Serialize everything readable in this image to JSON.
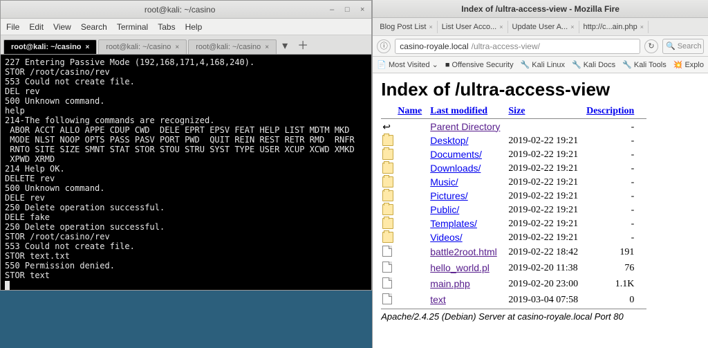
{
  "terminal": {
    "title": "root@kali: ~/casino",
    "menu": [
      "File",
      "Edit",
      "View",
      "Search",
      "Terminal",
      "Tabs",
      "Help"
    ],
    "tabs": [
      {
        "label": "root@kali: ~/casino",
        "active": true
      },
      {
        "label": "root@kali: ~/casino",
        "active": false
      },
      {
        "label": "root@kali: ~/casino",
        "active": false
      }
    ],
    "lines": [
      "227 Entering Passive Mode (192,168,171,4,168,240).",
      "STOR /root/casino/rev",
      "553 Could not create file.",
      "DEL rev",
      "500 Unknown command.",
      "help",
      "214-The following commands are recognized.",
      " ABOR ACCT ALLO APPE CDUP CWD  DELE EPRT EPSV FEAT HELP LIST MDTM MKD",
      " MODE NLST NOOP OPTS PASS PASV PORT PWD  QUIT REIN REST RETR RMD  RNFR",
      " RNTO SITE SIZE SMNT STAT STOR STOU STRU SYST TYPE USER XCUP XCWD XMKD",
      " XPWD XRMD",
      "214 Help OK.",
      "DELETE rev",
      "500 Unknown command.",
      "DELE rev",
      "250 Delete operation successful.",
      "DELE fake",
      "250 Delete operation successful.",
      "STOR /root/casino/rev",
      "553 Could not create file.",
      "STOR text.txt",
      "550 Permission denied.",
      "STOR text"
    ]
  },
  "browser": {
    "title": "Index of /ultra-access-view - Mozilla Fire",
    "tabs": [
      {
        "label": "Blog Post List"
      },
      {
        "label": "List User Acco..."
      },
      {
        "label": "Update User A..."
      },
      {
        "label": "http://c...ain.php"
      }
    ],
    "url_host": "casino-royale.local",
    "url_path": "/ultra-access-view/",
    "search_placeholder": "Search",
    "bookmarks": [
      "Most Visited",
      "Offensive Security",
      "Kali Linux",
      "Kali Docs",
      "Kali Tools",
      "Explo"
    ],
    "page": {
      "heading": "Index of /ultra-access-view",
      "cols": [
        "Name",
        "Last modified",
        "Size",
        "Description"
      ],
      "rows": [
        {
          "icon": "back",
          "name": "Parent Directory",
          "modified": "",
          "size": "-",
          "visited": true
        },
        {
          "icon": "folder",
          "name": "Desktop/",
          "modified": "2019-02-22 19:21",
          "size": "-"
        },
        {
          "icon": "folder",
          "name": "Documents/",
          "modified": "2019-02-22 19:21",
          "size": "-"
        },
        {
          "icon": "folder",
          "name": "Downloads/",
          "modified": "2019-02-22 19:21",
          "size": "-"
        },
        {
          "icon": "folder",
          "name": "Music/",
          "modified": "2019-02-22 19:21",
          "size": "-"
        },
        {
          "icon": "folder",
          "name": "Pictures/",
          "modified": "2019-02-22 19:21",
          "size": "-"
        },
        {
          "icon": "folder",
          "name": "Public/",
          "modified": "2019-02-22 19:21",
          "size": "-"
        },
        {
          "icon": "folder",
          "name": "Templates/",
          "modified": "2019-02-22 19:21",
          "size": "-"
        },
        {
          "icon": "folder",
          "name": "Videos/",
          "modified": "2019-02-22 19:21",
          "size": "-"
        },
        {
          "icon": "file",
          "name": "battle2root.html",
          "modified": "2019-02-22 18:42",
          "size": "191",
          "visited": true
        },
        {
          "icon": "file",
          "name": "hello_world.pl",
          "modified": "2019-02-20 11:38",
          "size": "76",
          "visited": true
        },
        {
          "icon": "file",
          "name": "main.php",
          "modified": "2019-02-20 23:00",
          "size": "1.1K",
          "visited": true
        },
        {
          "icon": "file",
          "name": "text",
          "modified": "2019-03-04 07:58",
          "size": "0",
          "visited": true
        }
      ],
      "footer": "Apache/2.4.25 (Debian) Server at casino-royale.local Port 80"
    }
  }
}
